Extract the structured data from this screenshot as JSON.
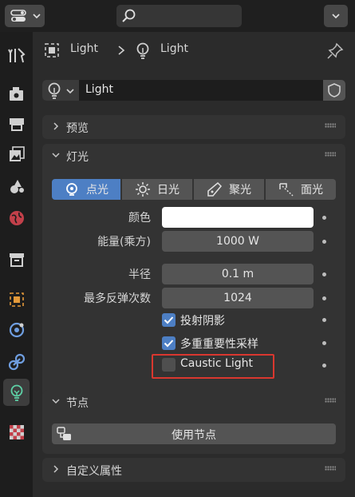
{
  "breadcrumb": {
    "object": "Light",
    "data": "Light"
  },
  "datablock": {
    "name": "Light"
  },
  "panels": {
    "preview": {
      "title": "预览"
    },
    "light": {
      "title": "灯光",
      "types": [
        {
          "label": "点光",
          "active": true
        },
        {
          "label": "日光",
          "active": false
        },
        {
          "label": "聚光",
          "active": false
        },
        {
          "label": "面光",
          "active": false
        }
      ],
      "color_label": "颜色",
      "color_value": "#ffffff",
      "power_label": "能量(乘方)",
      "power_value": "1000 W",
      "radius_label": "半径",
      "radius_value": "0.1 m",
      "bounces_label": "最多反弹次数",
      "bounces_value": "1024",
      "cast_shadow_label": "投射阴影",
      "cast_shadow_checked": true,
      "mis_label": "多重重要性采样",
      "mis_checked": true,
      "caustic_label": "Caustic Light",
      "caustic_checked": false,
      "highlight_color": "#d9372f"
    },
    "nodes": {
      "title": "节点",
      "use_nodes_label": "使用节点"
    },
    "custom_props": {
      "title": "自定义属性"
    }
  },
  "colors": {
    "accent": "#4d7fc4",
    "panel": "#333333",
    "field": "#545454"
  }
}
